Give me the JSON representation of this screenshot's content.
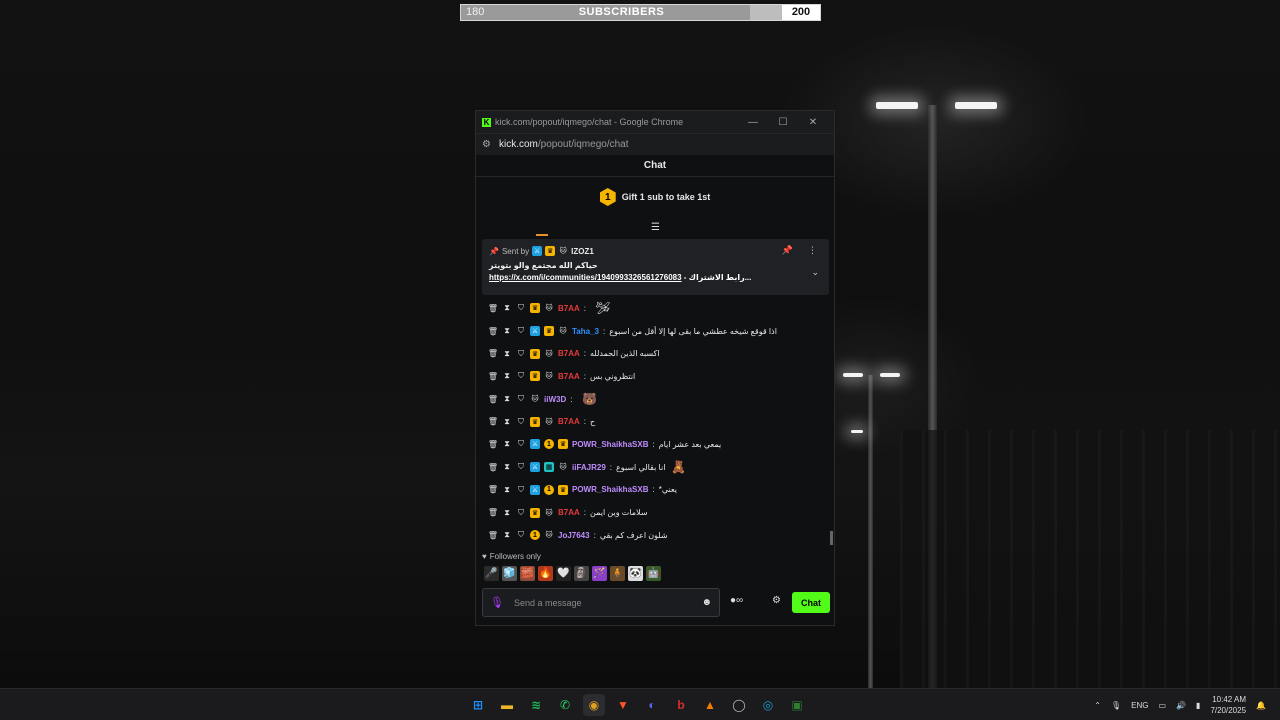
{
  "subscriber_bar": {
    "current": "180",
    "label": "SUBSCRIBERS",
    "goal": "200",
    "progress_fraction": 0.9
  },
  "window": {
    "title": "kick.com/popout/iqmego/chat - Google Chrome",
    "url_host": "kick.com",
    "url_path": "/popout/iqmego/chat",
    "controls": {
      "minimize": "—",
      "maximize": "☐",
      "close": "✕"
    }
  },
  "chat": {
    "header": "Chat",
    "gift_badge": "1",
    "gift_text": "Gift 1 sub to take 1st",
    "pinned": {
      "sent_by_label": "Sent by",
      "user": "IZOZ1",
      "line1": "حياكم الله مجتمع والو بتويتر",
      "link": "https://x.com/i/communities/1940993326561276083",
      "line2_suffix": " - رابط الاشتراك..."
    },
    "messages": [
      {
        "user": "B7AA",
        "color": "#e53a3a",
        "text": "",
        "emote": "🛩",
        "badges": [
          "crown",
          "cat"
        ]
      },
      {
        "user": "Taha_3",
        "color": "#2f8fff",
        "text": "اذا قوقع شيخه عطشي ما بقى لها إلا أقل من اسبوع",
        "emote": "",
        "badges": [
          "mod",
          "crown",
          "cat"
        ]
      },
      {
        "user": "B7AA",
        "color": "#e53a3a",
        "text": "اكسبه الذين الحمدلله",
        "emote": "",
        "badges": [
          "crown",
          "cat"
        ]
      },
      {
        "user": "B7AA",
        "color": "#e53a3a",
        "text": "انتظروني بس",
        "emote": "",
        "badges": [
          "crown",
          "cat"
        ]
      },
      {
        "user": "iiW3D",
        "color": "#c08cff",
        "text": "",
        "emote": "🐻",
        "badges": [
          "cat"
        ]
      },
      {
        "user": "B7AA",
        "color": "#e53a3a",
        "text": "ح",
        "emote": "",
        "badges": [
          "crown",
          "cat"
        ]
      },
      {
        "user": "POWR_ShaikhaSXB",
        "color": "#c08cff",
        "text": "يمعي بعد عشر ايام",
        "emote": "",
        "badges": [
          "mod",
          "gift",
          "crown"
        ]
      },
      {
        "user": "iiFAJR29",
        "color": "#c08cff",
        "text": "انا بقالي اسبوع",
        "emote": "🧸",
        "badges": [
          "mod",
          "grid",
          "cat"
        ]
      },
      {
        "user": "POWR_ShaikhaSXB",
        "color": "#c08cff",
        "text": "يعني*",
        "emote": "",
        "badges": [
          "mod",
          "gift",
          "crown"
        ]
      },
      {
        "user": "B7AA",
        "color": "#e53a3a",
        "text": "سلامات وين ايمن",
        "emote": "",
        "badges": [
          "crown",
          "cat"
        ]
      },
      {
        "user": "JoJ7643",
        "color": "#c08cff",
        "text": "شلون اعرف كم بقي",
        "emote": "",
        "badges": [
          "gift",
          "cat"
        ]
      }
    ],
    "followers_only": "Followers only",
    "emote_row": [
      "🎤",
      "🧊",
      "🧱",
      "🔥",
      "🤍",
      "🗿",
      "🪄",
      "🧍",
      "🐼",
      "🤖"
    ],
    "input_placeholder": "Send a message",
    "send_label": "Chat"
  },
  "taskbar": {
    "apps": [
      "windows",
      "file-explorer",
      "spotify",
      "whatsapp",
      "chrome",
      "brave",
      "discord",
      "app-red",
      "app-orange",
      "app-github",
      "steam",
      "app-green"
    ],
    "language": "ENG",
    "time": "10:42 AM",
    "date": "7/20/2025"
  },
  "colors": {
    "kick_green": "#53fc18",
    "gift_gold": "#f4b400"
  }
}
